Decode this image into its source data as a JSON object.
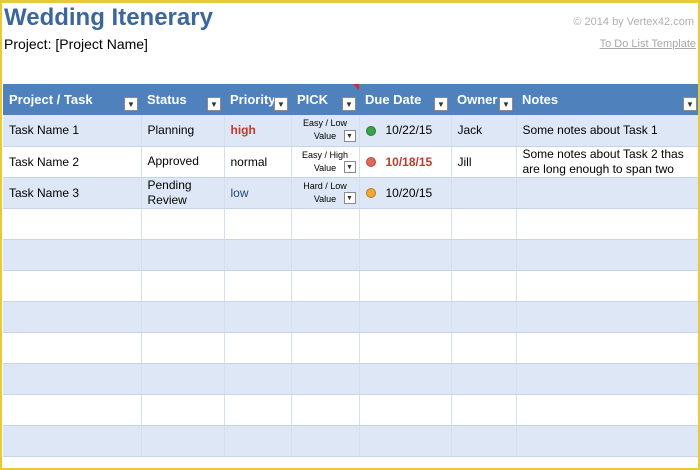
{
  "header": {
    "title": "Wedding Itenerary",
    "project": "Project: [Project Name]",
    "copyright": "© 2014 by Vertex42.com",
    "todo_link": "To Do List Template"
  },
  "table": {
    "columns": [
      {
        "label": "Project / Task"
      },
      {
        "label": "Status"
      },
      {
        "label": "Priority"
      },
      {
        "label": "PICK"
      },
      {
        "label": "Due Date"
      },
      {
        "label": "Owner"
      },
      {
        "label": "Notes"
      }
    ],
    "rows": [
      {
        "task": "Task Name 1",
        "status": "Planning",
        "priority": "high",
        "priority_level": "high",
        "pick": "Easy / Low Value",
        "due_indicator_color": "#3aa24a",
        "due": "10/22/15",
        "due_overdue": false,
        "owner": "Jack",
        "notes": "Some notes about Task 1"
      },
      {
        "task": "Task Name 2",
        "status": "Approved",
        "priority": "normal",
        "priority_level": "normal",
        "pick": "Easy / High Value",
        "due_indicator_color": "#e06a5a",
        "due": "10/18/15",
        "due_overdue": true,
        "owner": "Jill",
        "notes": "Some notes about Task 2 thas are long enough to span two"
      },
      {
        "task": "Task Name 3",
        "status": "Pending Review",
        "priority": "low",
        "priority_level": "low",
        "pick": "Hard / Low Value",
        "due_indicator_color": "#f0a830",
        "due": "10/20/15",
        "due_overdue": false,
        "owner": "",
        "notes": ""
      }
    ],
    "empty_rows": 8
  },
  "colors": {
    "header_bg": "#4f81bd",
    "title": "#3c679b",
    "band": "#dde7f5",
    "frame": "#e8c93a"
  }
}
